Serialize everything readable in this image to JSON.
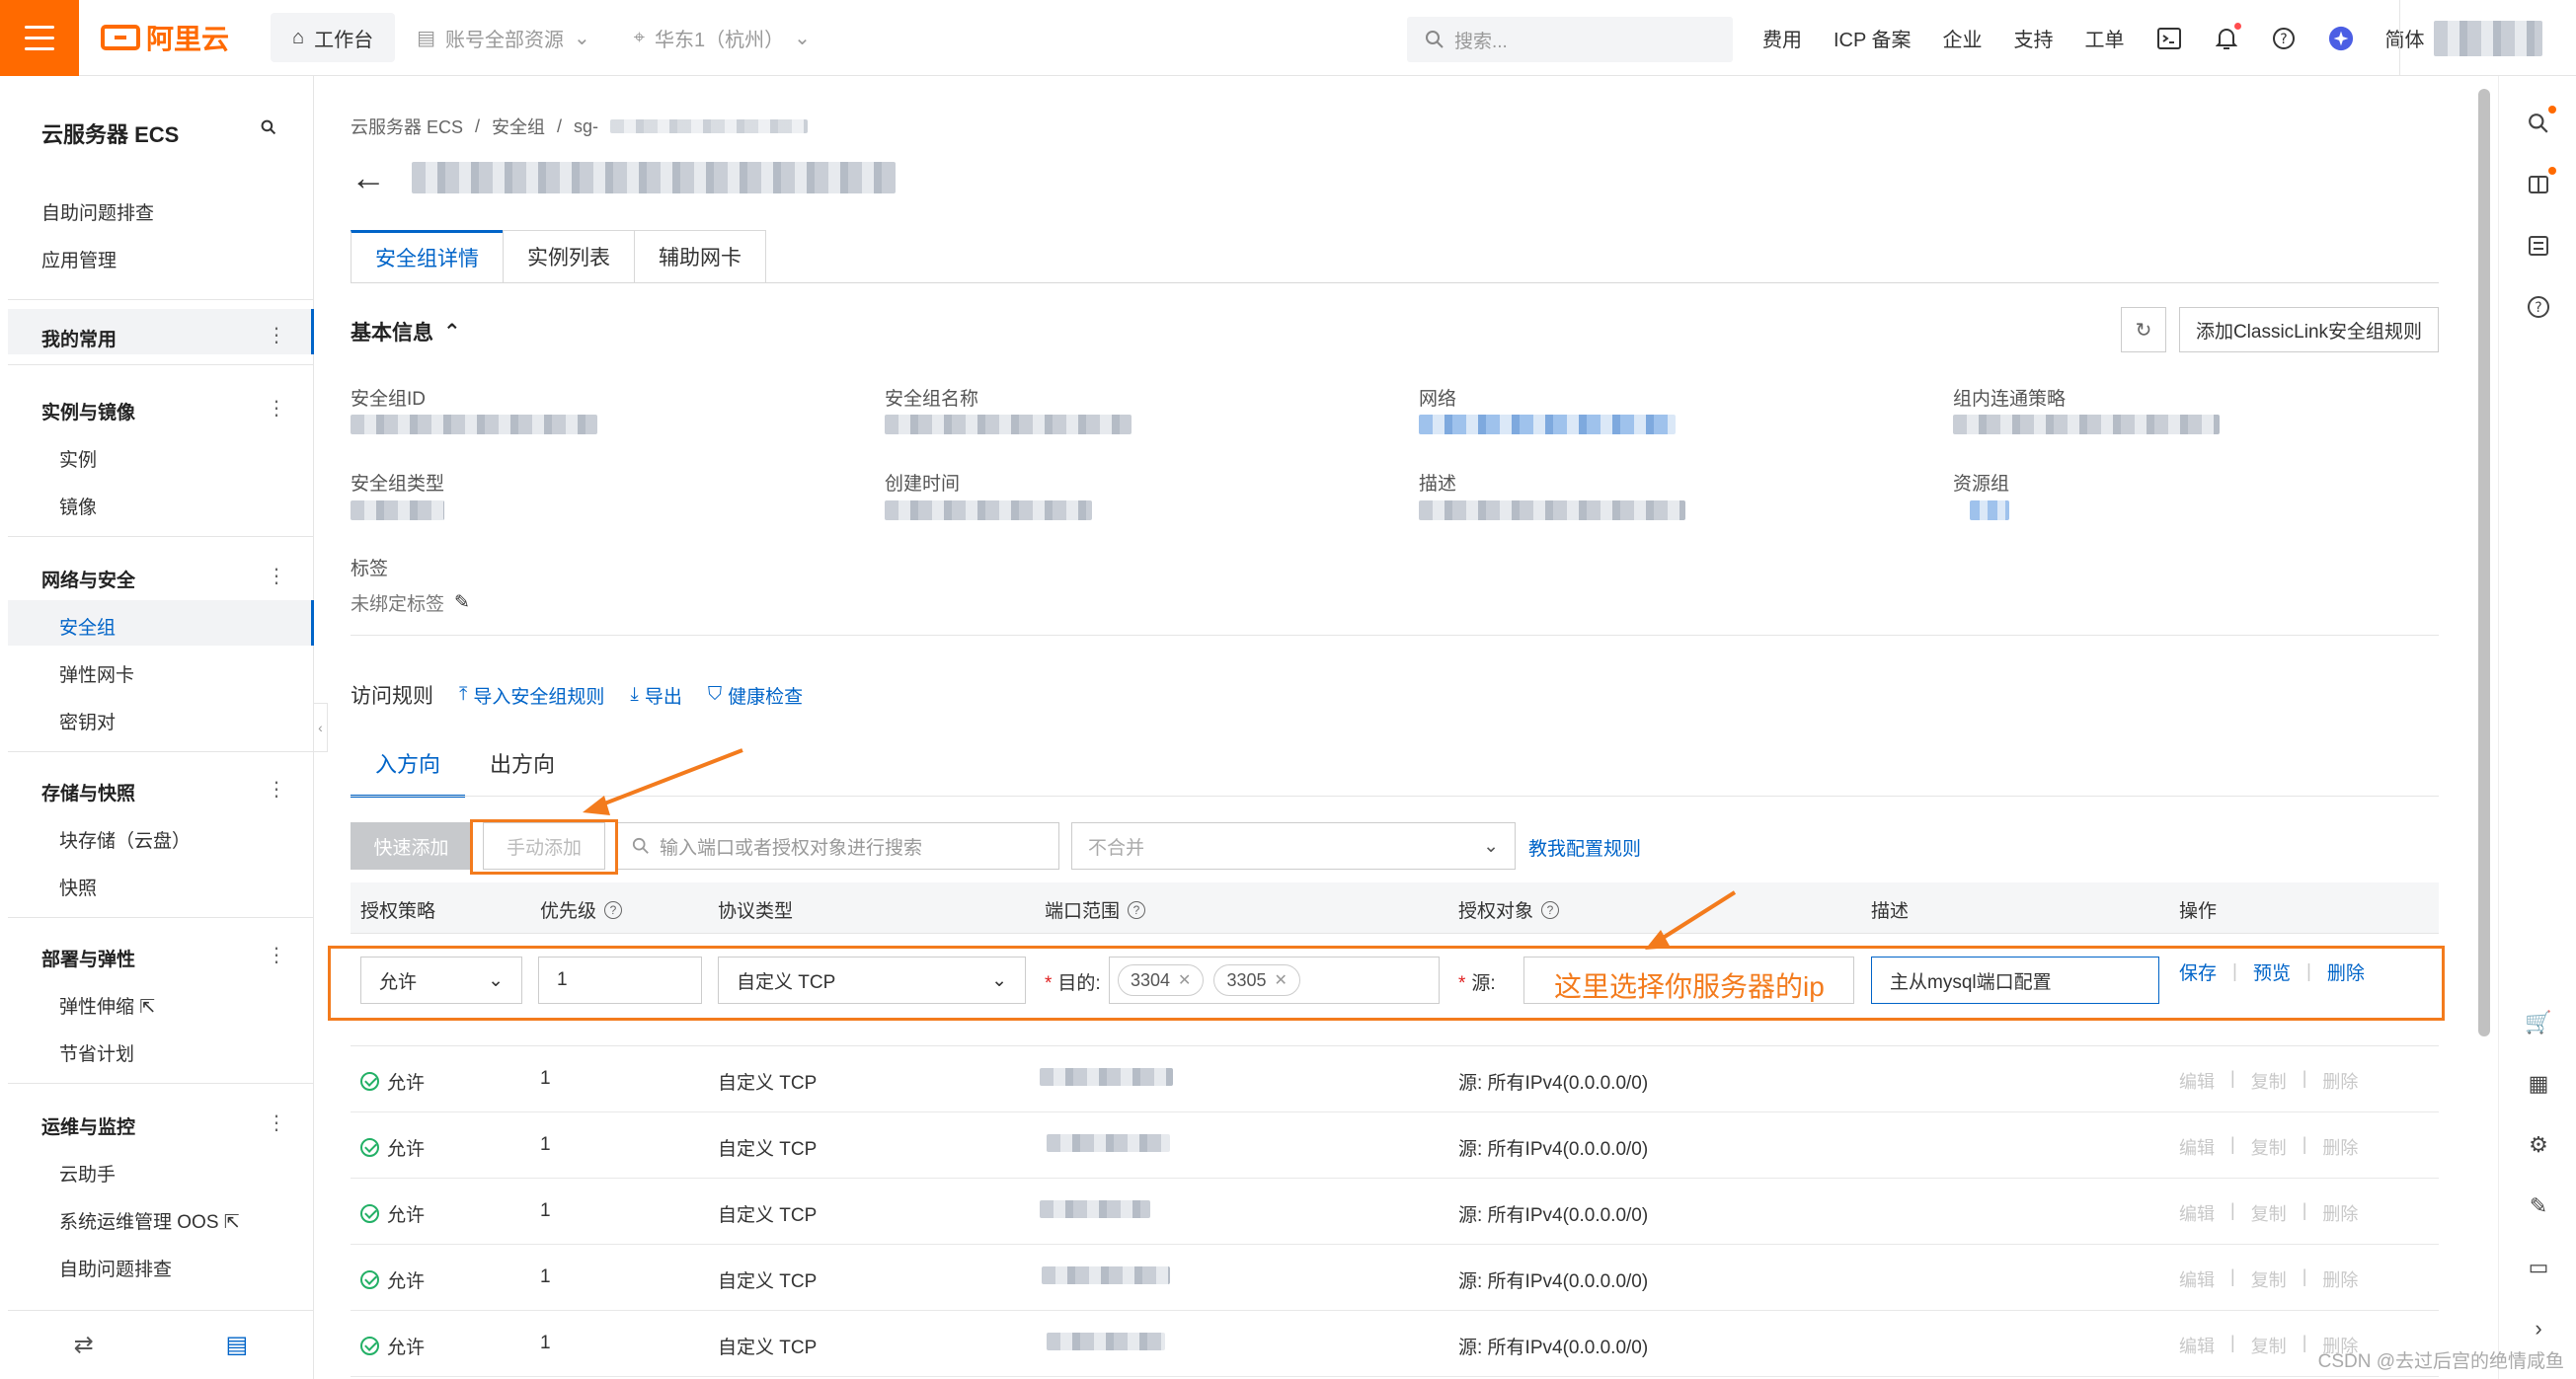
{
  "topbar": {
    "logo_text": "阿里云",
    "workbench": "工作台",
    "resources": "账号全部资源",
    "region": "华东1（杭州）",
    "search_placeholder": "搜索...",
    "nav": [
      "费用",
      "ICP 备案",
      "企业",
      "支持",
      "工单"
    ],
    "lang": "简体"
  },
  "sidebar": {
    "title": "云服务器 ECS",
    "top_items": [
      "自助问题排查",
      "应用管理"
    ],
    "favorites": "我的常用",
    "groups": [
      {
        "title": "实例与镜像",
        "items": [
          "实例",
          "镜像"
        ]
      },
      {
        "title": "网络与安全",
        "items": [
          "安全组",
          "弹性网卡",
          "密钥对"
        ]
      },
      {
        "title": "存储与快照",
        "items": [
          "块存储（云盘）",
          "快照"
        ]
      },
      {
        "title": "部署与弹性",
        "items": [
          "弹性伸缩",
          "节省计划"
        ]
      },
      {
        "title": "运维与监控",
        "items": [
          "云助手",
          "系统运维管理 OOS",
          "自助问题排查"
        ]
      }
    ],
    "selected": "安全组"
  },
  "breadcrumb": [
    "云服务器 ECS",
    "安全组",
    "sg-"
  ],
  "tabs": [
    "安全组详情",
    "实例列表",
    "辅助网卡"
  ],
  "basic_info": {
    "title": "基本信息",
    "classiclink_button": "添加ClassicLink安全组规则",
    "labels": [
      "安全组ID",
      "安全组名称",
      "网络",
      "组内连通策略",
      "安全组类型",
      "创建时间",
      "描述",
      "资源组"
    ],
    "tag_label": "标签",
    "tag_value": "未绑定标签"
  },
  "rules": {
    "title": "访问规则",
    "import": "导入安全组规则",
    "export": "导出",
    "health": "健康检查",
    "dir_tabs": [
      "入方向",
      "出方向"
    ],
    "quick_add": "快速添加",
    "manual_add": "手动添加",
    "search_placeholder": "输入端口或者授权对象进行搜索",
    "merge_select": "不合并",
    "teach_link": "教我配置规则",
    "columns": [
      "授权策略",
      "优先级",
      "协议类型",
      "端口范围",
      "授权对象",
      "描述",
      "操作"
    ]
  },
  "edit_row": {
    "policy": "允许",
    "priority": "1",
    "protocol": "自定义 TCP",
    "dest_label": "目的:",
    "ports": [
      "3304",
      "3305"
    ],
    "source_label": "源:",
    "description": "主从mysql端口配置",
    "actions": [
      "保存",
      "预览",
      "删除"
    ]
  },
  "data_rows": [
    {
      "policy": "允许",
      "priority": "1",
      "protocol": "自定义 TCP",
      "source": "源: 所有IPv4(0.0.0.0/0)"
    },
    {
      "policy": "允许",
      "priority": "1",
      "protocol": "自定义 TCP",
      "source": "源: 所有IPv4(0.0.0.0/0)"
    },
    {
      "policy": "允许",
      "priority": "1",
      "protocol": "自定义 TCP",
      "source": "源: 所有IPv4(0.0.0.0/0)"
    },
    {
      "policy": "允许",
      "priority": "1",
      "protocol": "自定义 TCP",
      "source": "源: 所有IPv4(0.0.0.0/0)"
    },
    {
      "policy": "允许",
      "priority": "1",
      "protocol": "自定义 TCP",
      "source": "源: 所有IPv4(0.0.0.0/0)"
    }
  ],
  "row_actions": [
    "编辑",
    "复制",
    "删除"
  ],
  "annotation": "这里选择你服务器的ip",
  "watermark": "CSDN @去过后宫的绝情咸鱼",
  "colors": {
    "brand": "#ff6a00",
    "link": "#0064c8",
    "annotation": "#f37b1d",
    "ok": "#23b066"
  }
}
